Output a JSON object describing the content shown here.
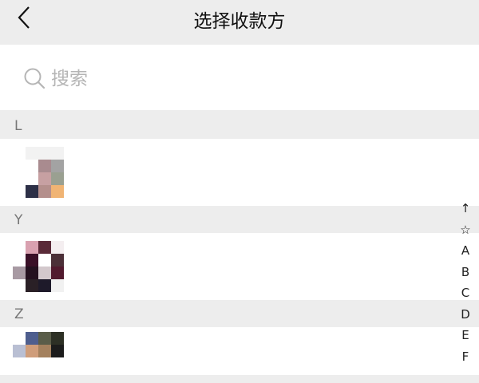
{
  "header": {
    "title": "选择收款方"
  },
  "search": {
    "placeholder": "搜索",
    "value": ""
  },
  "sections": [
    {
      "letter": "L"
    },
    {
      "letter": "Y"
    },
    {
      "letter": "Z"
    }
  ],
  "index_bar": [
    "↑",
    "☆",
    "A",
    "B",
    "C",
    "D",
    "E",
    "F"
  ]
}
